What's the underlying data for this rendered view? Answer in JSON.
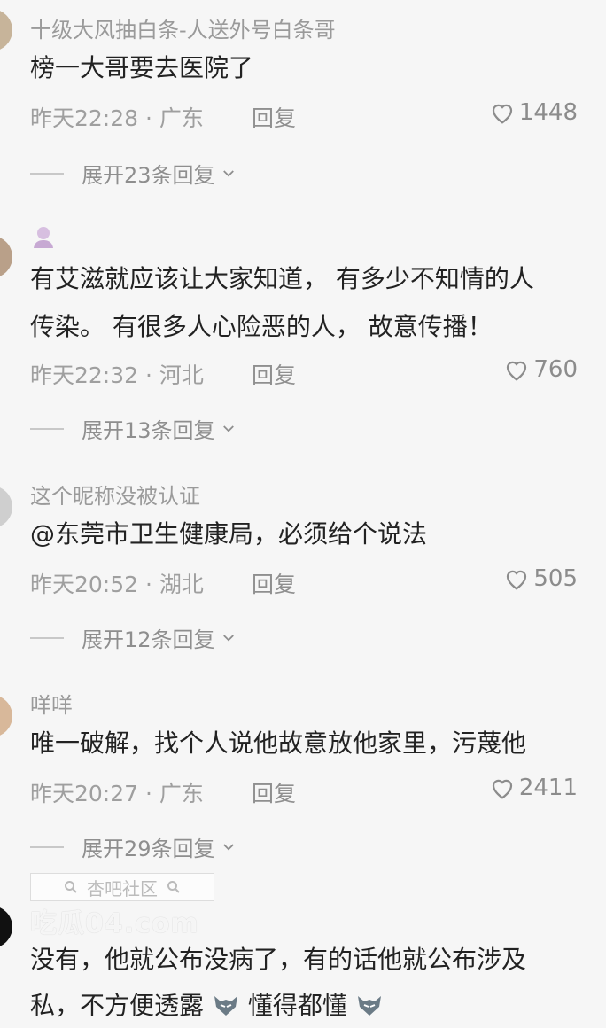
{
  "comments": [
    {
      "nickname": "十级大风抽白条-人送外号白条哥",
      "text_lines": [
        "榜一大哥要去医院了"
      ],
      "time": "昨天22:28",
      "location": "广东",
      "reply_label": "回复",
      "likes": "1448",
      "expand": "展开23条回复"
    },
    {
      "nickname": "",
      "text_lines": [
        "有艾滋就应该让大家知道， 有多少不知情的人",
        "传染。 有很多人心险恶的人， 故意传播！"
      ],
      "time": "昨天22:32",
      "location": "河北",
      "reply_label": "回复",
      "likes": "760",
      "expand": "展开13条回复"
    },
    {
      "nickname": "这个昵称没被认证",
      "text_lines": [
        "@东莞市卫生健康局，必须给个说法"
      ],
      "time": "昨天20:52",
      "location": "湖北",
      "reply_label": "回复",
      "likes": "505",
      "expand": "展开12条回复"
    },
    {
      "nickname": "咩咩",
      "text_lines": [
        "唯一破解，找个人说他故意放他家里，污蔑他"
      ],
      "time": "昨天20:27",
      "location": "广东",
      "reply_label": "回复",
      "likes": "2411",
      "expand": "展开29条回复"
    },
    {
      "nickname": "",
      "text_lines": [
        "没有，他就公布没病了，有的话他就公布涉及",
        "私，不方便透露",
        "懂得都懂"
      ]
    }
  ],
  "watermark": {
    "top": "杏吧社区",
    "bottom": "吃瓜04.com"
  },
  "colors": {
    "background": "#f6f6f6",
    "text": "#222222",
    "muted": "#9a9a9a"
  },
  "icons": [
    "heart-icon",
    "chevron-down-icon",
    "wolf-emoji-icon",
    "search-icon"
  ]
}
